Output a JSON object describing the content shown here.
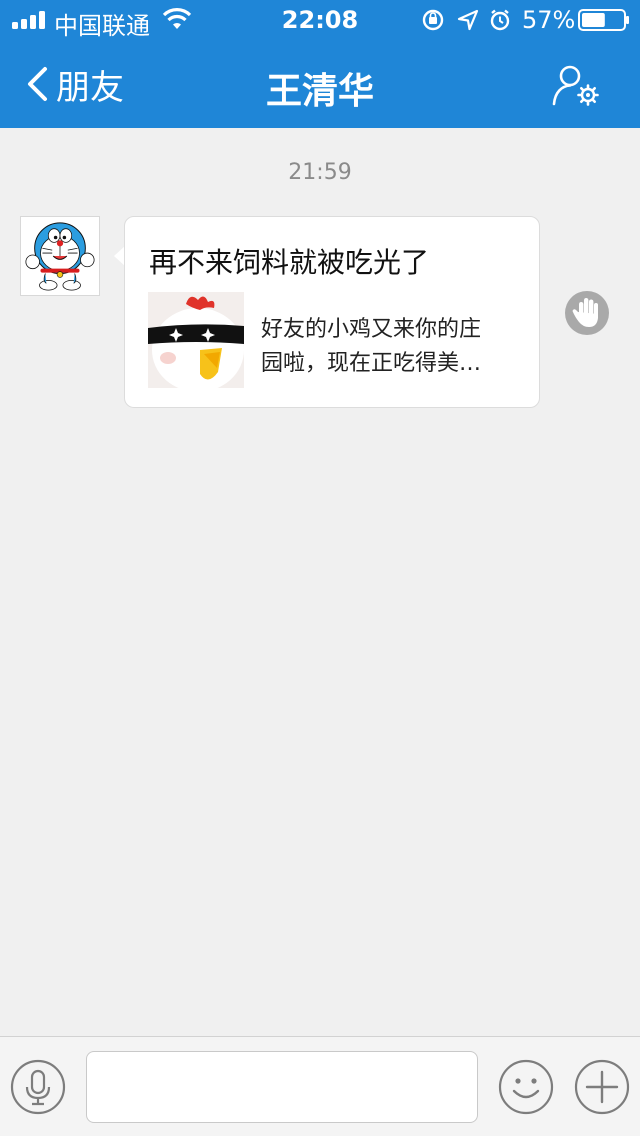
{
  "status_bar": {
    "carrier": "中国联通",
    "time": "22:08",
    "battery_percent": "57%",
    "battery_level": 0.57,
    "icons": [
      "signal-icon",
      "wifi-icon",
      "rotation-lock-icon",
      "location-icon",
      "alarm-icon",
      "battery-icon"
    ]
  },
  "navbar": {
    "back_label": "朋友",
    "title": "王清华",
    "right_icon": "profile-settings-icon",
    "color": "#1f86d7"
  },
  "chat": {
    "timestamp": "21:59",
    "messages": [
      {
        "avatar": "doraemon-avatar",
        "title": "再不来饲料就被吃光了",
        "thumbnail": "chicken-thumbnail",
        "description_lines": [
          "好友的小鸡又来你的庄",
          "园啦，现在正吃得美…"
        ],
        "side_icon": "hand-icon"
      }
    ]
  },
  "input_bar": {
    "voice_icon": "microphone-icon",
    "placeholder": "",
    "emoji_icon": "smiley-icon",
    "more_icon": "plus-icon"
  }
}
